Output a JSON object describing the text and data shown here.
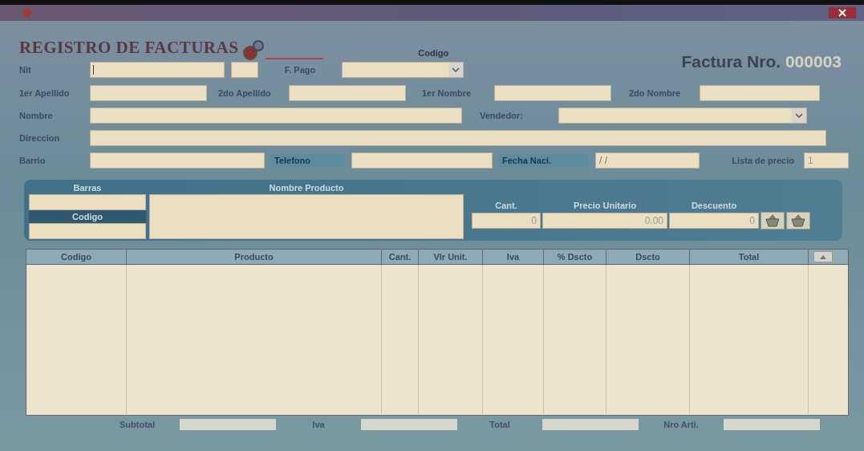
{
  "header": {
    "title": "REGISTRO DE FACTURAS",
    "codigo_label": "Codigo",
    "invoice_label": "Factura Nro.",
    "invoice_number": "000003"
  },
  "form": {
    "nit": {
      "label": "Nit"
    },
    "pago": {
      "label": "F. Pago"
    },
    "apellido1": {
      "label": "1er Apellido"
    },
    "apellido2": {
      "label": "2do Apellido"
    },
    "nombre1": {
      "label": "1er Nombre"
    },
    "nombre2": {
      "label": "2do Nombre"
    },
    "nombre": {
      "label": "Nombre"
    },
    "vendedor": {
      "label": "Vendedor:"
    },
    "direccion": {
      "label": "Direccion"
    },
    "barrio": {
      "label": "Barrio"
    },
    "telefono": {
      "label": "Telefono"
    },
    "fecha": {
      "label": "Fecha Naci.",
      "placeholder": "/ /"
    },
    "lista": {
      "label": "Lista de precio",
      "value": "1"
    }
  },
  "product_entry": {
    "barras_label": "Barras",
    "codigo_label": "Codigo",
    "nombre_label": "Nombre Producto",
    "cant": {
      "label": "Cant.",
      "value": "0"
    },
    "precio": {
      "label": "Precio Unitario",
      "value": "0.00"
    },
    "descuento": {
      "label": "Descuento",
      "value": "0"
    }
  },
  "table": {
    "columns": [
      "Codigo",
      "Producto",
      "Cant.",
      "Vlr Unit.",
      "Iva",
      "% Dscto",
      "Dscto",
      "Total"
    ]
  },
  "totals": [
    {
      "label": "Subtotal"
    },
    {
      "label": "Iva"
    },
    {
      "label": "Total"
    },
    {
      "label": "Nro Arti."
    }
  ]
}
